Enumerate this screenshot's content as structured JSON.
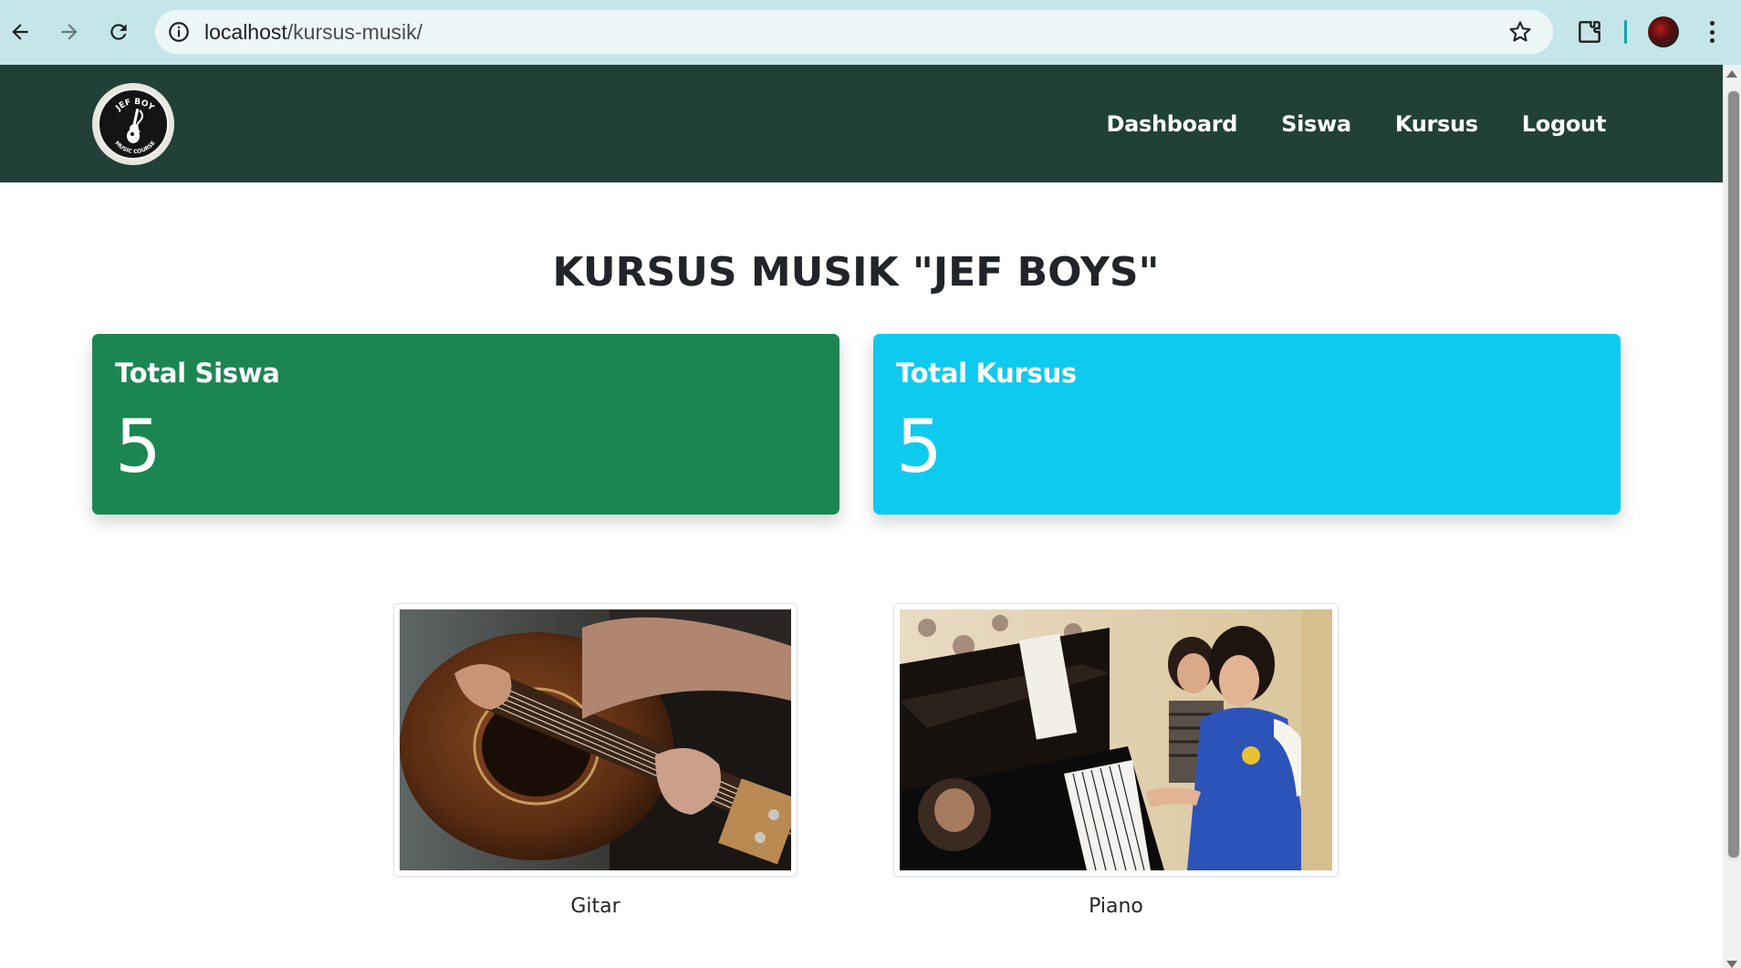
{
  "browser": {
    "url_host": "localhost",
    "url_path": "/kursus-musik/",
    "icons": [
      "back-icon",
      "forward-icon",
      "reload-icon",
      "site-info-icon",
      "bookmark-star-icon",
      "extensions-icon",
      "profile-avatar",
      "menu-icon"
    ]
  },
  "navbar": {
    "logo_text_top": "JEF BOY",
    "logo_text_bottom": "MUSIC COURSE",
    "links": [
      "Dashboard",
      "Siswa",
      "Kursus",
      "Logout"
    ],
    "background": "#214038"
  },
  "main": {
    "title": "KURSUS MUSIK \"JEF BOYS\"",
    "cards": [
      {
        "label": "Total Siswa",
        "value": "5",
        "color": "#1c8652"
      },
      {
        "label": "Total Kursus",
        "value": "5",
        "color": "#0fcaef"
      }
    ],
    "gallery": [
      {
        "caption": "Gitar"
      },
      {
        "caption": "Piano"
      }
    ]
  }
}
